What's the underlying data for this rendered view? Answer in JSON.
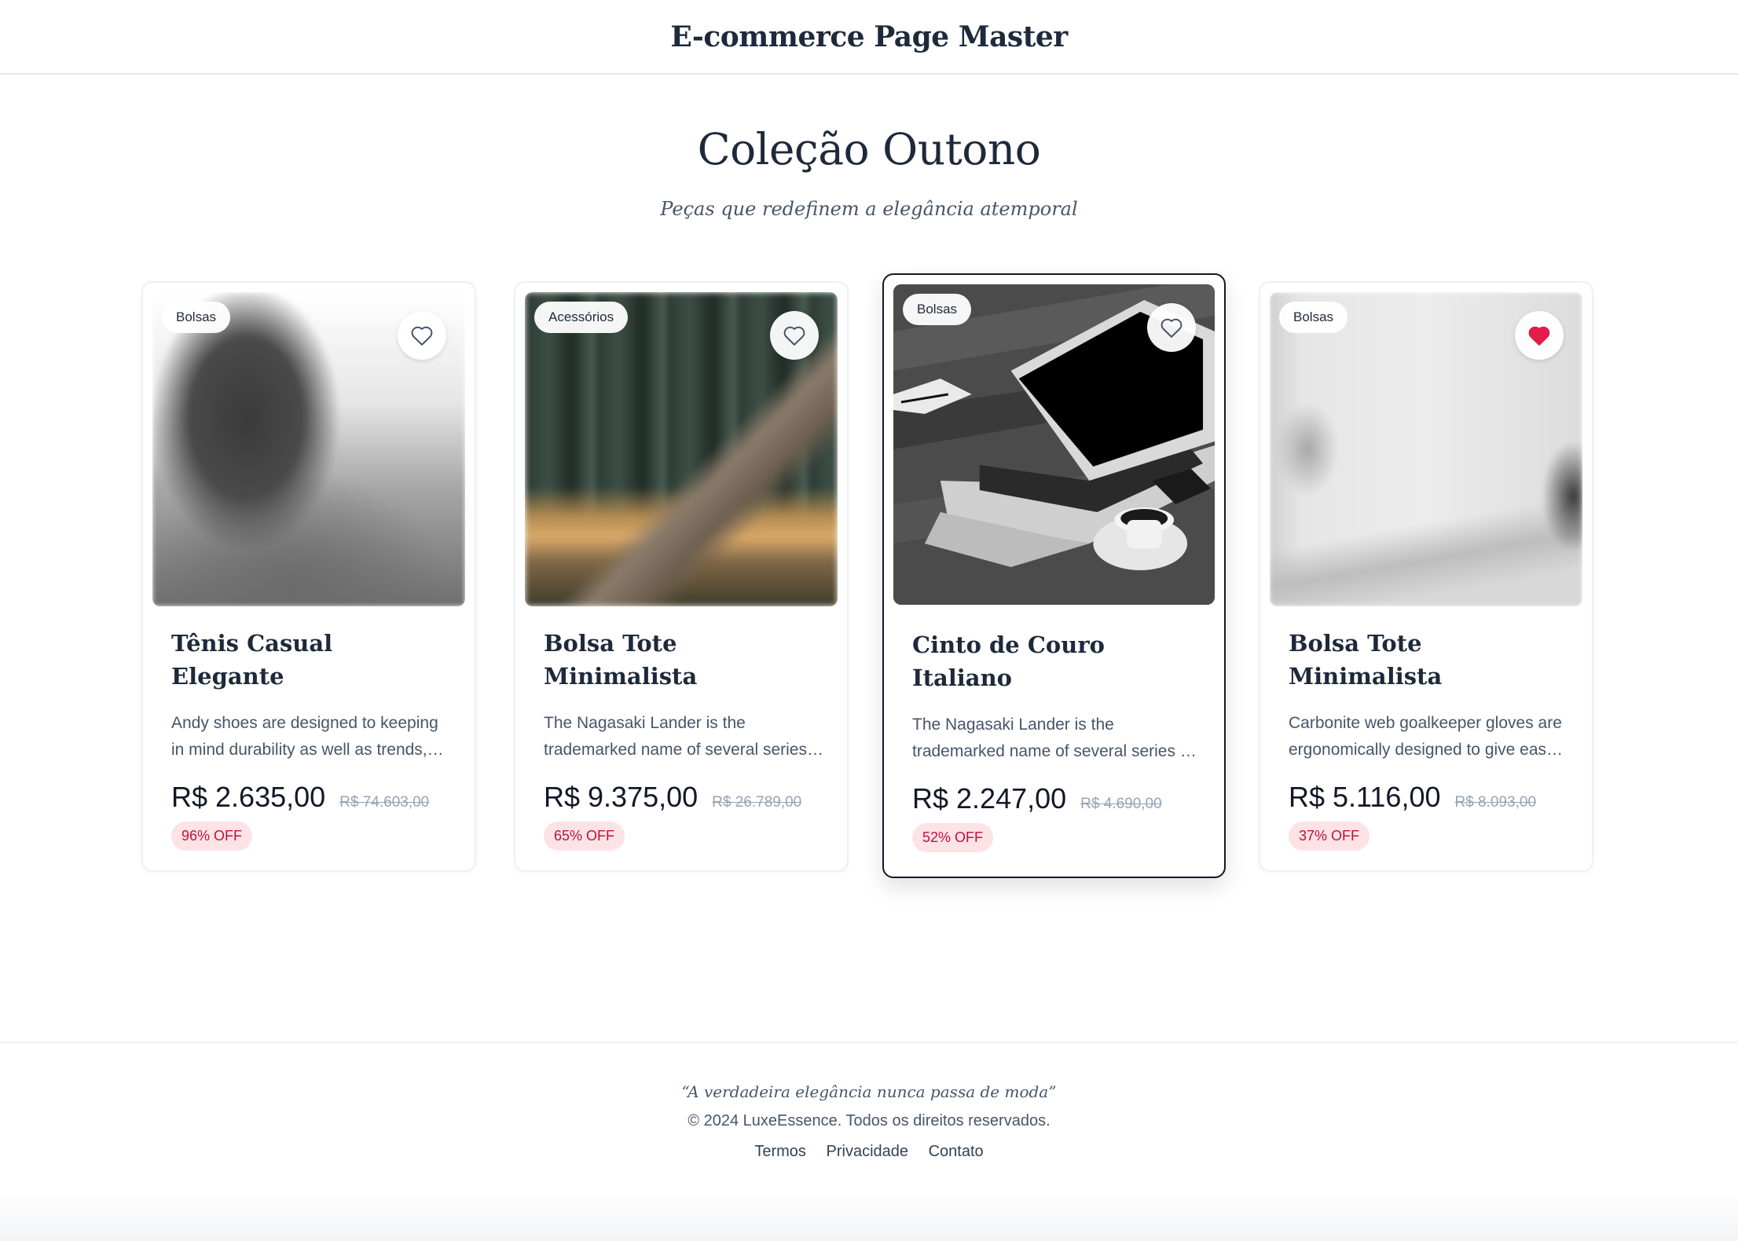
{
  "header": {
    "title": "E-commerce Page Master"
  },
  "hero": {
    "title": "Coleção Outono",
    "subtitle": "Peças que redefinem a elegância atemporal"
  },
  "products": [
    {
      "category": "Bolsas",
      "title": "Tênis Casual Elegante",
      "description": "Andy shoes are designed to keeping in mind durability as well as trends, the most stylish range of shoes & sandals",
      "price": "R$ 2.635,00",
      "old_price": "R$ 74.603,00",
      "discount": "96% OFF",
      "favorite": false,
      "image_icon": "blurred-portrait-image"
    },
    {
      "category": "Acessórios",
      "title": "Bolsa Tote Minimalista",
      "description": "The Nagasaki Lander is the trademarked name of several series of Nagasaki sport bikes",
      "price": "R$ 9.375,00",
      "old_price": "R$ 26.789,00",
      "discount": "65% OFF",
      "favorite": false,
      "image_icon": "blurred-forest-image"
    },
    {
      "category": "Bolsas",
      "title": "Cinto de Couro Italiano",
      "description": "The Nagasaki Lander is the trademarked name of several series of Nagasaki sport bikes",
      "price": "R$ 2.247,00",
      "old_price": "R$ 4.690,00",
      "discount": "52% OFF",
      "favorite": false,
      "image_icon": "laptop-image"
    },
    {
      "category": "Bolsas",
      "title": "Bolsa Tote Minimalista",
      "description": "Carbonite web goalkeeper gloves are ergonomically designed to give easy fit",
      "price": "R$ 5.116,00",
      "old_price": "R$ 8.093,00",
      "discount": "37% OFF",
      "favorite": true,
      "image_icon": "blurred-desk-image"
    }
  ],
  "footer": {
    "quote": "“A verdadeira elegância nunca passa de moda”",
    "copyright": "© 2024 LuxeEssence. Todos os direitos reservados.",
    "links": [
      "Termos",
      "Privacidade",
      "Contato"
    ]
  },
  "colors": {
    "text_primary": "#1e293b",
    "discount_bg": "#fde2e6",
    "discount_text": "#be123c",
    "favorite_heart": "#e11d48",
    "heart_outline": "#475569"
  }
}
